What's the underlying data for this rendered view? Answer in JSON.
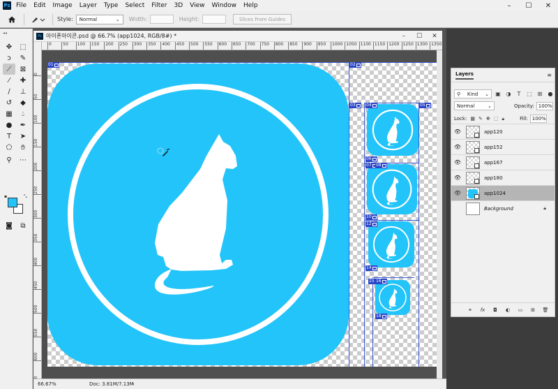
{
  "app": {
    "logo": "Ps"
  },
  "menu": [
    "File",
    "Edit",
    "Image",
    "Layer",
    "Type",
    "Select",
    "Filter",
    "3D",
    "View",
    "Window",
    "Help"
  ],
  "window_controls": [
    "–",
    "☐",
    "✕"
  ],
  "options": {
    "style_label": "Style:",
    "style_value": "Normal",
    "width_label": "Width:",
    "height_label": "Height:",
    "slices_button": "Slices From Guides"
  },
  "document": {
    "tab_title": "아이폰아이콘.psd @ 66.7% (app1024, RGB/8#) *",
    "tab_controls": [
      "–",
      "☐",
      "✕"
    ],
    "ruler_top": [
      "0",
      "50",
      "100",
      "150",
      "200",
      "250",
      "300",
      "350",
      "400",
      "450",
      "500",
      "550",
      "600",
      "650",
      "700",
      "750",
      "800",
      "850",
      "900",
      "950",
      "1000",
      "1050",
      "1100",
      "1150",
      "1200",
      "1250",
      "1300",
      "1350"
    ],
    "ruler_left": [
      "0",
      "50",
      "100",
      "150",
      "200",
      "250",
      "300",
      "350",
      "400",
      "450",
      "500",
      "550",
      "600",
      "650"
    ],
    "slices": [
      {
        "id": "01"
      },
      {
        "id": "02"
      },
      {
        "id": "03"
      },
      {
        "id": "04"
      },
      {
        "id": "05"
      },
      {
        "id": "06"
      },
      {
        "id": "07"
      },
      {
        "id": "08"
      },
      {
        "id": "10"
      },
      {
        "id": "12"
      },
      {
        "id": "14"
      },
      {
        "id": "15"
      },
      {
        "id": "16"
      },
      {
        "id": "18"
      }
    ],
    "icon_color": "#22c4f9"
  },
  "status": {
    "zoom": "66.67%",
    "doc": "Doc: 3.81M/7.13M",
    "arrow": "›"
  },
  "layers_panel": {
    "title": "Layers",
    "filter_kind": "Kind",
    "blend_mode": "Normal",
    "opacity_label": "Opacity:",
    "opacity_value": "100%",
    "lock_label": "Lock:",
    "fill_label": "Fill:",
    "fill_value": "100%",
    "layers": [
      {
        "name": "app120",
        "visible": true,
        "selected": false
      },
      {
        "name": "app152",
        "visible": true,
        "selected": false
      },
      {
        "name": "app167",
        "visible": true,
        "selected": false
      },
      {
        "name": "app180",
        "visible": true,
        "selected": false
      },
      {
        "name": "app1024",
        "visible": true,
        "selected": true
      },
      {
        "name": "Background",
        "visible": false,
        "selected": false
      }
    ],
    "footer_icons": [
      "link-icon",
      "fx-icon",
      "mask-icon",
      "adjustment-icon",
      "folder-icon",
      "new-layer-icon",
      "trash-icon"
    ]
  }
}
